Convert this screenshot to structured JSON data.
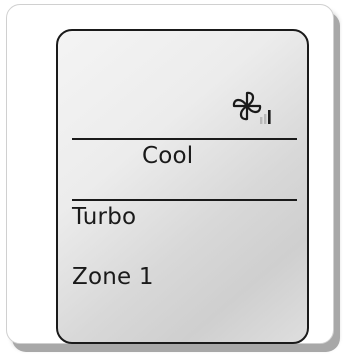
{
  "display": {
    "mode": "Cool",
    "feature": "Turbo",
    "zone": "Zone 1"
  },
  "icons": {
    "fan": "fan-icon",
    "fan_speed": "fan-speed-bars-icon"
  },
  "colors": {
    "ink": "#1a1a1a",
    "screen_light": "#f4f4f4",
    "screen_dark": "#cfcfcf",
    "shadow": "#a8a8a8"
  }
}
